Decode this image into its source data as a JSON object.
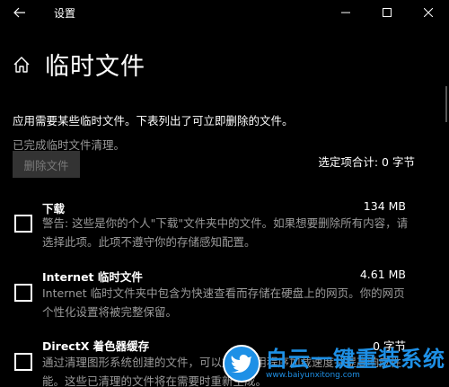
{
  "titlebar": {
    "title": "设置",
    "back_icon": "arrow-left-icon",
    "minimize_icon": "minimize-icon",
    "maximize_icon": "maximize-icon",
    "close_icon": "close-icon"
  },
  "header": {
    "icon": "home-icon",
    "title": "临时文件"
  },
  "description": "应用需要某些临时文件。下表列出了可立即删除的文件。",
  "status_text": "已完成临时文件清理。",
  "delete_button": "删除文件",
  "total_selected": "选定项合计: 0 字节",
  "items": [
    {
      "name": "下载",
      "size": "134 MB",
      "description": "警告: 这些是你的个人\"下载\"文件夹中的文件。如果想要删除所有内容，请选择此项。此项不遵守你的存储感知配置。",
      "checked": false
    },
    {
      "name": "Internet 临时文件",
      "size": "4.61 MB",
      "description": "Internet 临时文件夹中包含为快速查看而存储在硬盘上的网页。你的网页个性化设置将被完整保留。",
      "checked": false
    },
    {
      "name": "DirectX 着色器缓存",
      "size": "0 字节",
      "description": "通过清理图形系统创建的文件，可以加快应用程序加载速度并提高响应性能。这些已清理的文件将在需要时重新生成。",
      "checked": false
    }
  ],
  "watermark": {
    "main": "白云一键重装系统",
    "sub": "www.baiyunxitong.com",
    "icon": "bird-logo-icon"
  },
  "colors": {
    "background": "#000000",
    "text": "#ffffff",
    "secondary_text": "#9a9a9a",
    "button_disabled_bg": "#333333",
    "watermark_blue": "#1e90e6"
  }
}
